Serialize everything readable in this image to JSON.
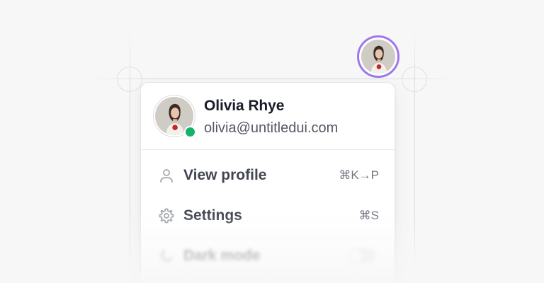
{
  "trigger": {
    "ring_color": "#9e77ed",
    "avatar": "avatar-photo"
  },
  "user": {
    "name": "Olivia Rhye",
    "email": "olivia@untitledui.com",
    "status": "online",
    "status_color": "#17b26a"
  },
  "menu": {
    "items": [
      {
        "label": "View profile",
        "shortcut": "⌘K→P",
        "icon": "user-icon"
      },
      {
        "label": "Settings",
        "shortcut": "⌘S",
        "icon": "gear-icon"
      },
      {
        "label": "Dark mode",
        "icon": "moon-icon",
        "toggle": false
      }
    ]
  }
}
